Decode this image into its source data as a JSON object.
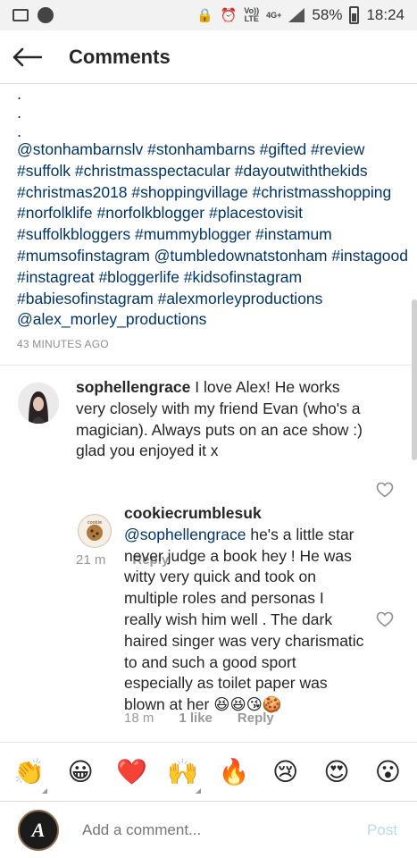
{
  "status_bar": {
    "carrier_1": "Vo))",
    "carrier_1b": "LTE",
    "carrier_2": "4G+",
    "battery": "58%",
    "time": "18:24"
  },
  "header": {
    "title": "Comments"
  },
  "caption": {
    "dots": [
      ".",
      ".",
      "."
    ],
    "text": "@stonhambarnslv #stonhambarns #gifted #review #suffolk #christmasspectacular #dayoutwiththekids #christmas2018 #shoppingvillage #christmasshopping #norfolklife #norfolkblogger #placestovisit #suffolkbloggers #mummyblogger #instamum #mumsofinstagram @tumbledownatstonham #instagood #instagreat #bloggerlife #kidsofinstagram #babiesofinstagram #alexmorleyproductions @alex_morley_productions",
    "time": "43 MINUTES AGO"
  },
  "comments": [
    {
      "username": "sophellengrace",
      "text": " I love Alex! He works very closely with my friend Evan (who's a magician). Always puts on an ace show :) glad you enjoyed it x",
      "time": "21 m",
      "reply": "Reply"
    },
    {
      "username": "cookiecrumblesuk",
      "mention": "@sophellengrace",
      "text": "  he's a little star never judge a book hey ! He was witty very quick and took on multiple roles and personas I really wish him well . The dark haired singer was very charismatic to and such a good sport especially as toilet paper was blown at her 😆😆😘🍪",
      "time": "18 m",
      "likes": "1 like",
      "reply": "Reply"
    }
  ],
  "emoji_bar": [
    "👏",
    "😀",
    "❤️",
    "🙌",
    "🔥",
    "😢",
    "😍",
    "😮"
  ],
  "add_comment": {
    "placeholder": "Add a comment...",
    "post_label": "Post",
    "avatar_text": "A"
  },
  "colors": {
    "link": "#003569",
    "muted": "#8e8e8e",
    "post_disabled": "#b7d9f5"
  }
}
